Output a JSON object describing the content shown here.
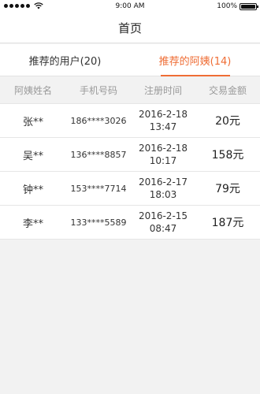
{
  "status_bar": {
    "time": "9:00 AM",
    "battery": "100%",
    "battery_level": 1.0,
    "signal_icon": "signal-dots-icon",
    "wifi_icon": "wifi-icon"
  },
  "nav": {
    "title": "首页"
  },
  "tabs": [
    {
      "label": "推荐的用户(20)",
      "active": false
    },
    {
      "label": "推荐的阿姨(14)",
      "active": true
    }
  ],
  "table": {
    "headers": [
      "阿姨姓名",
      "手机号码",
      "注册时间",
      "交易金额"
    ],
    "rows": [
      {
        "name": "张**",
        "phone": "186****3026",
        "date": "2016-2-18",
        "time": "13:47",
        "amount": "20元"
      },
      {
        "name": "吴**",
        "phone": "136****8857",
        "date": "2016-2-18",
        "time": "10:17",
        "amount": "158元"
      },
      {
        "name": "钟**",
        "phone": "153****7714",
        "date": "2016-2-17",
        "time": "18:03",
        "amount": "79元"
      },
      {
        "name": "李**",
        "phone": "133****5589",
        "date": "2016-2-15",
        "time": "08:47",
        "amount": "187元"
      }
    ]
  },
  "colors": {
    "accent": "#ef6d35",
    "background": "#f2f2f2"
  }
}
